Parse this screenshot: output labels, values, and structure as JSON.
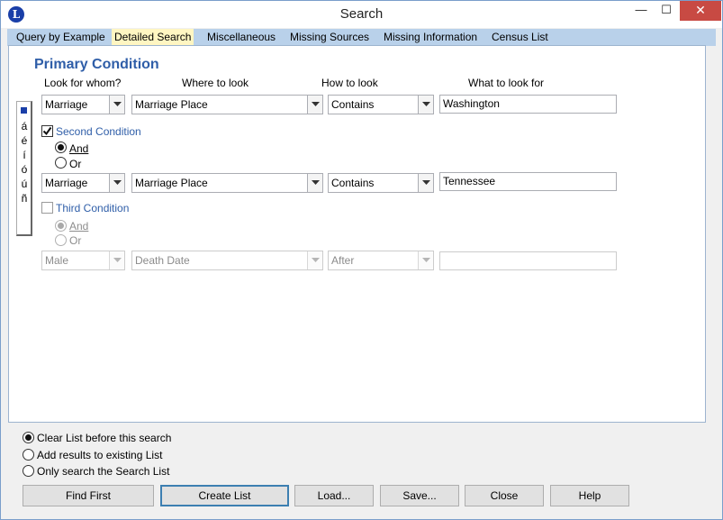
{
  "window": {
    "title": "Search",
    "app_icon_letter": "L",
    "min": "—",
    "max": "☐",
    "close": "✕"
  },
  "tabs": [
    {
      "label": "Query by Example"
    },
    {
      "label": "Detailed Search"
    },
    {
      "label": "Miscellaneous"
    },
    {
      "label": "Missing Sources"
    },
    {
      "label": "Missing Information"
    },
    {
      "label": "Census List"
    }
  ],
  "primary": {
    "heading": "Primary Condition",
    "col_whom": "Look for whom?",
    "col_where": "Where to look",
    "col_how": "How to look",
    "col_what": "What to look for",
    "whom": "Marriage",
    "where": "Marriage Place",
    "how": "Contains",
    "what": "Washington"
  },
  "second": {
    "label": "Second Condition",
    "checked": true,
    "and_label": "And",
    "or_label": "Or",
    "whom": "Marriage",
    "where": "Marriage Place",
    "how": "Contains",
    "what": "Tennessee"
  },
  "third": {
    "label": "Third Condition",
    "checked": false,
    "and_label": "And",
    "or_label": "Or",
    "whom": "Male",
    "where": "Death Date",
    "how": "After",
    "what": ""
  },
  "chars": [
    "á",
    "é",
    "í",
    "ó",
    "ú",
    "ñ"
  ],
  "list_options": [
    {
      "label": "Clear List before this search",
      "selected": true
    },
    {
      "label": "Add results to existing List",
      "selected": false
    },
    {
      "label": "Only search the Search List",
      "selected": false
    }
  ],
  "buttons": {
    "find_first": "Find First",
    "create_list": "Create List",
    "load": "Load...",
    "save": "Save...",
    "close": "Close",
    "help": "Help"
  }
}
